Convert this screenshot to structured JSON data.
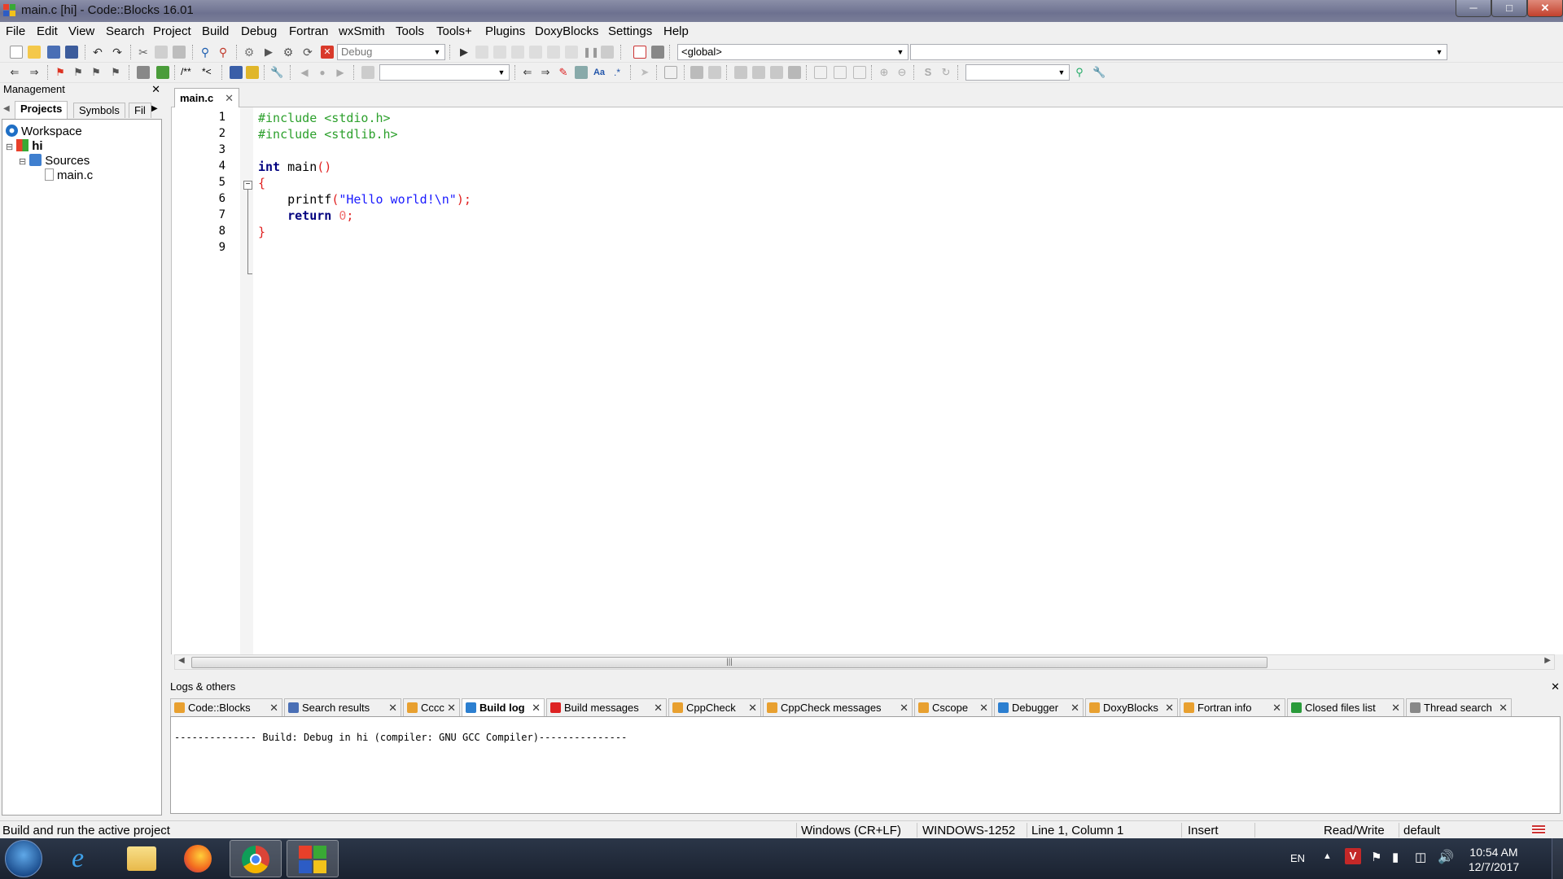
{
  "window": {
    "title": "main.c [hi] - Code::Blocks 16.01"
  },
  "menu": [
    "File",
    "Edit",
    "View",
    "Search",
    "Project",
    "Build",
    "Debug",
    "Fortran",
    "wxSmith",
    "Tools",
    "Tools+",
    "Plugins",
    "DoxyBlocks",
    "Settings",
    "Help"
  ],
  "toolbar": {
    "build_target": "Debug",
    "scope": "<global>",
    "function": "",
    "search_combo": "",
    "doc_comment": "/**",
    "inline_comment": "*<"
  },
  "management": {
    "title": "Management",
    "tabs": [
      "Projects",
      "Symbols",
      "Fil"
    ],
    "tree": {
      "workspace": "Workspace",
      "project": "hi",
      "folder": "Sources",
      "file": "main.c"
    }
  },
  "editor": {
    "tab_label": "main.c",
    "lines": [
      {
        "n": "1",
        "parts": [
          [
            "pp",
            "#include <stdio.h>"
          ]
        ]
      },
      {
        "n": "2",
        "parts": [
          [
            "pp",
            "#include <stdlib.h>"
          ]
        ]
      },
      {
        "n": "3",
        "parts": []
      },
      {
        "n": "4",
        "parts": [
          [
            "kw",
            "int"
          ],
          [
            "tx",
            " main"
          ],
          [
            "op",
            "()"
          ]
        ]
      },
      {
        "n": "5",
        "parts": [
          [
            "op",
            "{"
          ]
        ]
      },
      {
        "n": "6",
        "parts": [
          [
            "tx",
            "    printf"
          ],
          [
            "op",
            "("
          ],
          [
            "st",
            "\"Hello world!\\n\""
          ],
          [
            "op",
            ");"
          ]
        ]
      },
      {
        "n": "7",
        "parts": [
          [
            "kw",
            "    return"
          ],
          [
            "tx",
            " "
          ],
          [
            "nm",
            "0"
          ],
          [
            "op",
            ";"
          ]
        ]
      },
      {
        "n": "8",
        "parts": [
          [
            "op",
            "}"
          ]
        ]
      },
      {
        "n": "9",
        "parts": []
      }
    ]
  },
  "logs": {
    "title": "Logs & others",
    "tabs": [
      {
        "label": "Code::Blocks",
        "active": false
      },
      {
        "label": "Search results",
        "active": false
      },
      {
        "label": "Cccc",
        "active": false
      },
      {
        "label": "Build log",
        "active": true
      },
      {
        "label": "Build messages",
        "active": false
      },
      {
        "label": "CppCheck",
        "active": false
      },
      {
        "label": "CppCheck messages",
        "active": false
      },
      {
        "label": "Cscope",
        "active": false
      },
      {
        "label": "Debugger",
        "active": false
      },
      {
        "label": "DoxyBlocks",
        "active": false
      },
      {
        "label": "Fortran info",
        "active": false
      },
      {
        "label": "Closed files list",
        "active": false
      },
      {
        "label": "Thread search",
        "active": false
      }
    ],
    "build_log_line": "-------------- Build: Debug in hi (compiler: GNU GCC Compiler)---------------"
  },
  "statusbar": {
    "message": "Build and run the active project",
    "line_endings": "Windows (CR+LF)",
    "encoding": "WINDOWS-1252",
    "position": "Line 1, Column 1",
    "mode": "Insert",
    "access": "Read/Write",
    "profile": "default"
  },
  "taskbar": {
    "language": "EN",
    "time": "10:54 AM",
    "date": "12/7/2017"
  },
  "colors": {
    "preprocessor": "#2ca02c",
    "keyword": "#00007f",
    "operator": "#e02020",
    "string": "#1a1aff",
    "number": "#f07070"
  }
}
